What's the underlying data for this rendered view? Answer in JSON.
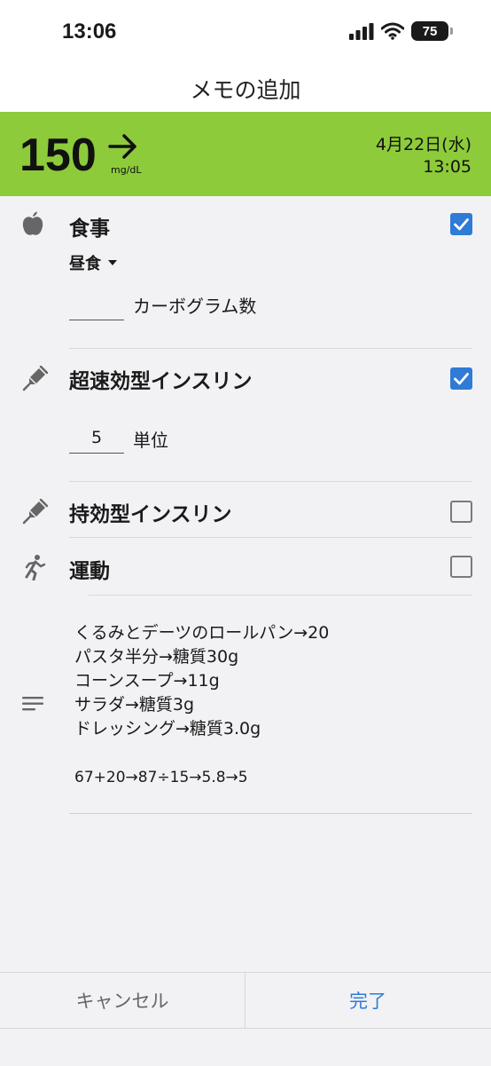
{
  "status_bar": {
    "time": "13:06",
    "battery_level": "75"
  },
  "header": {
    "title": "メモの追加"
  },
  "glucose": {
    "value": "150",
    "unit": "mg/dL",
    "trend_icon": "arrow-right-icon",
    "date": "4月22日(水)",
    "time": "13:05",
    "banner_color": "#8dcb3a"
  },
  "meal": {
    "title": "食事",
    "checked": true,
    "meal_type": "昼食",
    "carb_value": "",
    "carb_label": "カーボグラム数"
  },
  "rapid_insulin": {
    "title": "超速効型インスリン",
    "checked": true,
    "units_value": "5",
    "units_label": "単位"
  },
  "long_insulin": {
    "title": "持効型インスリン",
    "checked": false
  },
  "exercise": {
    "title": "運動",
    "checked": false
  },
  "notes": {
    "lines": [
      "くるみとデーツのロールパン→20",
      "パスタ半分→糖質30g",
      "コーンスープ→11g",
      "サラダ→糖質3g",
      "ドレッシング→糖質3.0g"
    ],
    "calculation": "67+20→87÷15→5.8→5"
  },
  "footer": {
    "cancel_label": "キャンセル",
    "done_label": "完了"
  },
  "colors": {
    "accent": "#2f7bd6",
    "background": "#f2f2f5"
  }
}
